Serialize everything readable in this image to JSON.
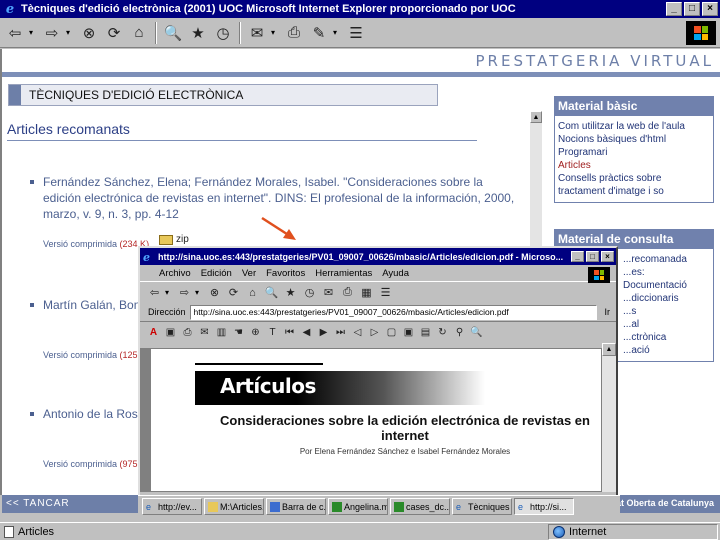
{
  "window": {
    "title": "Tècniques d'edició electrònica (2001)   UOC   Microsoft Internet Explorer proporcionado por UOC",
    "buttons": {
      "minimize": "_",
      "maximize": "□",
      "close": "×"
    }
  },
  "toolbar": {
    "icons": [
      "back-arrow",
      "forward-arrow",
      "stop",
      "refresh",
      "home",
      "search",
      "favorites",
      "history",
      "mail",
      "print",
      "edit",
      "discuss"
    ]
  },
  "page": {
    "brand": "PRESTATGERIA VIRTUAL",
    "section_title": "TÈCNIQUES D'EDICIÓ ELECTRÒNICA",
    "articles_heading": "Articles recomanats",
    "articles": [
      {
        "text": "Fernández Sánchez, Elena; Fernández Morales, Isabel. \"Consideraciones sobre la edición electrónica de revistas en internet\". DINS: El profesional de la información, 2000, marzo, v. 9, n. 3, pp. 4-12"
      },
      {
        "text": "Martín Galán, Bonifacio ... mediante XML: un ..."
      },
      {
        "text": "Antonio de la Rosa ... DINS: El profesion ..."
      }
    ],
    "printed": [
      {
        "label": "Versió comprimida",
        "size": "(234 K)"
      },
      {
        "label": "Versió comprimida",
        "size": "(125 K)"
      },
      {
        "label": "Versió comprimida",
        "size": "(975 K)"
      }
    ],
    "zip_label": "zip",
    "side_basic": {
      "title": "Material bàsic",
      "links": [
        "Com utilitzar la web de l'aula",
        "Nocions bàsiques d'html",
        "Programari",
        "Articles",
        "Consells pràctics sobre",
        "tractament d'imatge i so"
      ]
    },
    "side_consulta": {
      "title": "Material de consulta",
      "links": [
        "...recomanada",
        "...es: Documentació",
        "",
        "...diccionaris",
        "...s",
        "...al",
        "...ctrònica",
        "...ació"
      ]
    },
    "footer_left": "<< TANCAR",
    "footer_right": "Universitat Oberta de Catalunya"
  },
  "status": {
    "text": "Articles",
    "zone": "Internet"
  },
  "pdf_window": {
    "title": "http://sina.uoc.es:443/prestatgeries/PV01_09007_00626/mbasic/Articles/edicion.pdf - Microso...",
    "menu": [
      "Archivo",
      "Edición",
      "Ver",
      "Favoritos",
      "Herramientas",
      "Ayuda"
    ],
    "address_label": "Dirección",
    "address_value": "http://sina.uoc.es:443/prestatgeries/PV01_09007_00626/mbasic/Articles/edicion.pdf",
    "go_label": "Ir",
    "doc": {
      "banner": "Artículos",
      "title": "Consideraciones sobre la edición electrónica de revistas en internet",
      "author": "Por Elena Fernández Sánchez e Isabel Fernández Morales"
    }
  },
  "taskbar": {
    "tasks": [
      "http://ev...",
      "M:\\Articles...",
      "Barra de c...",
      "Angelina.m...",
      "cases_dc...",
      "Tècniques ...",
      "http://si..."
    ]
  }
}
